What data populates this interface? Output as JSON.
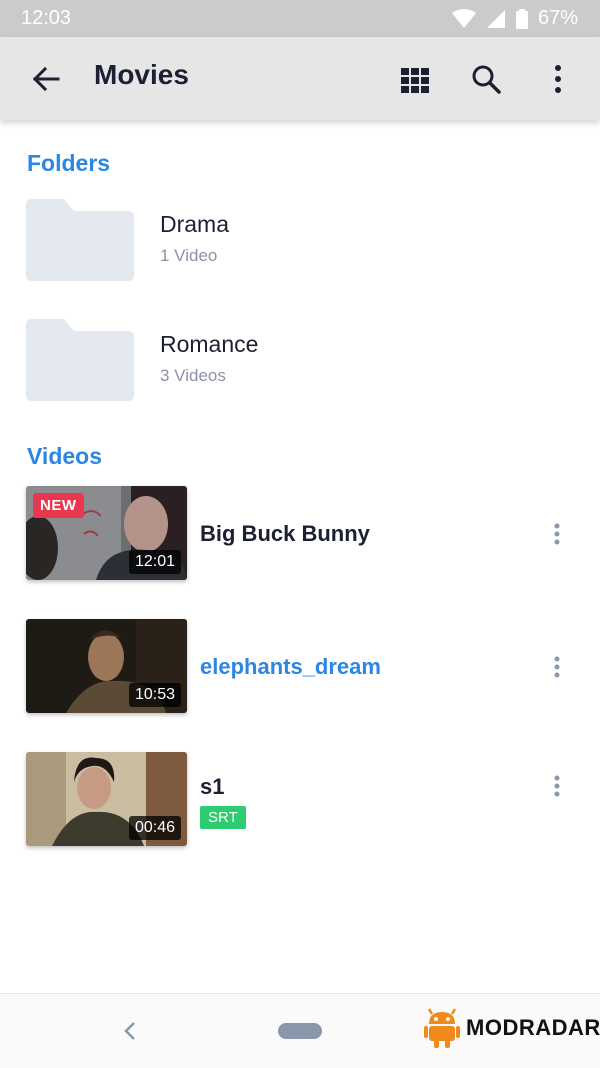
{
  "status_bar": {
    "time": "12:03",
    "battery": "67%"
  },
  "app_bar": {
    "title": "Movies",
    "icons": [
      "arrow-back-icon",
      "grid-view-icon",
      "search-icon",
      "more-vert-icon"
    ]
  },
  "folders_section": {
    "title": "Folders",
    "items": [
      {
        "name": "Drama",
        "count": "1 Video"
      },
      {
        "name": "Romance",
        "count": "3 Videos"
      }
    ]
  },
  "videos_section": {
    "title": "Videos",
    "items": [
      {
        "title": "Big Buck Bunny",
        "duration": "12:01",
        "badge": "NEW",
        "active": false
      },
      {
        "title": "elephants_dream",
        "duration": "10:53",
        "active": true
      },
      {
        "title": "s1",
        "duration": "00:46",
        "subtitle_badge": "SRT",
        "active": false
      }
    ]
  },
  "watermark": {
    "text": "MODRADAR"
  },
  "colors": {
    "accent": "#2b86e4",
    "new_badge": "#e8374f",
    "srt_badge": "#2ecc71",
    "app_bar": "#e6e6e6",
    "status_bar": "#cbcbcb"
  }
}
